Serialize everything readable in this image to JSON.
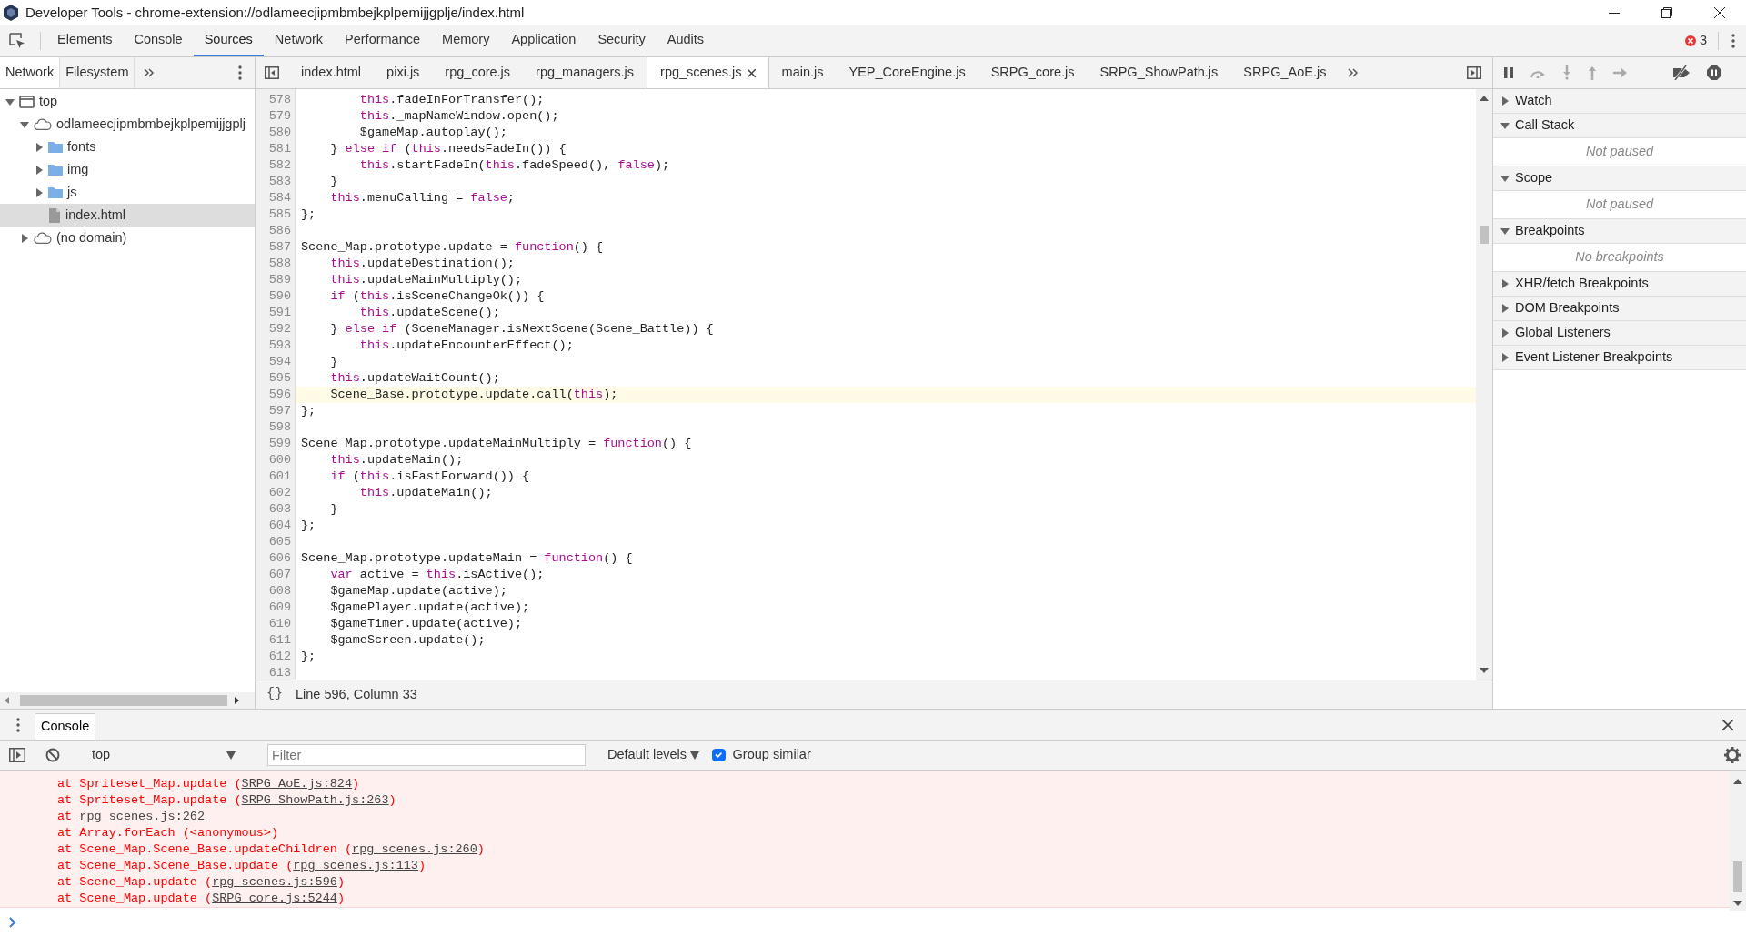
{
  "window": {
    "title": "Developer Tools - chrome-extension://odlameecjipmbmbejkplpemijjgplje/index.html"
  },
  "main_tabs": [
    {
      "label": "Elements",
      "selected": false
    },
    {
      "label": "Console",
      "selected": false
    },
    {
      "label": "Sources",
      "selected": true
    },
    {
      "label": "Network",
      "selected": false
    },
    {
      "label": "Performance",
      "selected": false
    },
    {
      "label": "Memory",
      "selected": false
    },
    {
      "label": "Application",
      "selected": false
    },
    {
      "label": "Security",
      "selected": false
    },
    {
      "label": "Audits",
      "selected": false
    }
  ],
  "error_count": "3",
  "navigator": {
    "tabs": [
      {
        "label": "Network",
        "selected": true
      },
      {
        "label": "Filesystem",
        "selected": false
      }
    ],
    "tree": [
      {
        "label": "top",
        "kind": "frame",
        "expanded": true,
        "selected": false,
        "children": [
          {
            "label": "odlameecjipmbmbejkplpemijjgplj",
            "kind": "domain",
            "expanded": true,
            "selected": false,
            "children": [
              {
                "label": "fonts",
                "kind": "folder",
                "expanded": false,
                "selected": false
              },
              {
                "label": "img",
                "kind": "folder",
                "expanded": false,
                "selected": false
              },
              {
                "label": "js",
                "kind": "folder",
                "expanded": false,
                "selected": false
              },
              {
                "label": "index.html",
                "kind": "file",
                "selected": true
              }
            ]
          },
          {
            "label": "(no domain)",
            "kind": "domain",
            "expanded": false,
            "selected": false
          }
        ]
      }
    ]
  },
  "editor_tabs": [
    {
      "label": "index.html",
      "selected": false
    },
    {
      "label": "pixi.js",
      "selected": false
    },
    {
      "label": "rpg_core.js",
      "selected": false
    },
    {
      "label": "rpg_managers.js",
      "selected": false
    },
    {
      "label": "rpg_scenes.js",
      "selected": true
    },
    {
      "label": "main.js",
      "selected": false
    },
    {
      "label": "YEP_CoreEngine.js",
      "selected": false
    },
    {
      "label": "SRPG_core.js",
      "selected": false
    },
    {
      "label": "SRPG_ShowPath.js",
      "selected": false
    },
    {
      "label": "SRPG_AoE.js",
      "selected": false
    }
  ],
  "code": {
    "lines": [
      {
        "number": "578",
        "current": false,
        "tokens": [
          {
            "kind": "keyword",
            "text": "        this"
          },
          {
            "kind": "plain",
            "text": ".fadeInForTransfer();"
          }
        ]
      },
      {
        "number": "579",
        "current": false,
        "tokens": [
          {
            "kind": "keyword",
            "text": "        this"
          },
          {
            "kind": "plain",
            "text": "._mapNameWindow.open();"
          }
        ]
      },
      {
        "number": "580",
        "current": false,
        "tokens": [
          {
            "kind": "plain",
            "text": "        $gameMap.autoplay();"
          }
        ]
      },
      {
        "number": "581",
        "current": false,
        "tokens": [
          {
            "kind": "plain",
            "text": "    } "
          },
          {
            "kind": "keyword",
            "text": "else if"
          },
          {
            "kind": "plain",
            "text": " ("
          },
          {
            "kind": "keyword",
            "text": "this"
          },
          {
            "kind": "plain",
            "text": ".needsFadeIn()) {"
          }
        ]
      },
      {
        "number": "582",
        "current": false,
        "tokens": [
          {
            "kind": "keyword",
            "text": "        this"
          },
          {
            "kind": "plain",
            "text": ".startFadeIn("
          },
          {
            "kind": "keyword",
            "text": "this"
          },
          {
            "kind": "plain",
            "text": ".fadeSpeed(), "
          },
          {
            "kind": "keyword",
            "text": "false"
          },
          {
            "kind": "plain",
            "text": ");"
          }
        ]
      },
      {
        "number": "583",
        "current": false,
        "tokens": [
          {
            "kind": "plain",
            "text": "    }"
          }
        ]
      },
      {
        "number": "584",
        "current": false,
        "tokens": [
          {
            "kind": "keyword",
            "text": "    this"
          },
          {
            "kind": "plain",
            "text": ".menuCalling = "
          },
          {
            "kind": "keyword",
            "text": "false"
          },
          {
            "kind": "plain",
            "text": ";"
          }
        ]
      },
      {
        "number": "585",
        "current": false,
        "tokens": [
          {
            "kind": "plain",
            "text": "};"
          }
        ]
      },
      {
        "number": "586",
        "current": false
      },
      {
        "number": "587",
        "current": false,
        "tokens": [
          {
            "kind": "plain",
            "text": "Scene_Map.prototype.update = "
          },
          {
            "kind": "keyword",
            "text": "function"
          },
          {
            "kind": "plain",
            "text": "() {"
          }
        ]
      },
      {
        "number": "588",
        "current": false,
        "tokens": [
          {
            "kind": "keyword",
            "text": "    this"
          },
          {
            "kind": "plain",
            "text": ".updateDestination();"
          }
        ]
      },
      {
        "number": "589",
        "current": false,
        "tokens": [
          {
            "kind": "keyword",
            "text": "    this"
          },
          {
            "kind": "plain",
            "text": ".updateMainMultiply();"
          }
        ]
      },
      {
        "number": "590",
        "current": false,
        "tokens": [
          {
            "kind": "keyword",
            "text": "    if"
          },
          {
            "kind": "plain",
            "text": " ("
          },
          {
            "kind": "keyword",
            "text": "this"
          },
          {
            "kind": "plain",
            "text": ".isSceneChangeOk()) {"
          }
        ]
      },
      {
        "number": "591",
        "current": false,
        "tokens": [
          {
            "kind": "keyword",
            "text": "        this"
          },
          {
            "kind": "plain",
            "text": ".updateScene();"
          }
        ]
      },
      {
        "number": "592",
        "current": false,
        "tokens": [
          {
            "kind": "plain",
            "text": "    } "
          },
          {
            "kind": "keyword",
            "text": "else if"
          },
          {
            "kind": "plain",
            "text": " (SceneManager.isNextScene(Scene_Battle)) {"
          }
        ]
      },
      {
        "number": "593",
        "current": false,
        "tokens": [
          {
            "kind": "keyword",
            "text": "        this"
          },
          {
            "kind": "plain",
            "text": ".updateEncounterEffect();"
          }
        ]
      },
      {
        "number": "594",
        "current": false,
        "tokens": [
          {
            "kind": "plain",
            "text": "    }"
          }
        ]
      },
      {
        "number": "595",
        "current": false,
        "tokens": [
          {
            "kind": "keyword",
            "text": "    this"
          },
          {
            "kind": "plain",
            "text": ".updateWaitCount();"
          }
        ]
      },
      {
        "number": "596",
        "current": true,
        "tokens": [
          {
            "kind": "plain",
            "text": "    Scene_Base.prototype.update.call("
          },
          {
            "kind": "keyword",
            "text": "this"
          },
          {
            "kind": "plain",
            "text": ");"
          }
        ]
      },
      {
        "number": "597",
        "current": false,
        "tokens": [
          {
            "kind": "plain",
            "text": "};"
          }
        ]
      },
      {
        "number": "598",
        "current": false
      },
      {
        "number": "599",
        "current": false,
        "tokens": [
          {
            "kind": "plain",
            "text": "Scene_Map.prototype.updateMainMultiply = "
          },
          {
            "kind": "keyword",
            "text": "function"
          },
          {
            "kind": "plain",
            "text": "() {"
          }
        ]
      },
      {
        "number": "600",
        "current": false,
        "tokens": [
          {
            "kind": "keyword",
            "text": "    this"
          },
          {
            "kind": "plain",
            "text": ".updateMain();"
          }
        ]
      },
      {
        "number": "601",
        "current": false,
        "tokens": [
          {
            "kind": "keyword",
            "text": "    if"
          },
          {
            "kind": "plain",
            "text": " ("
          },
          {
            "kind": "keyword",
            "text": "this"
          },
          {
            "kind": "plain",
            "text": ".isFastForward()) {"
          }
        ]
      },
      {
        "number": "602",
        "current": false,
        "tokens": [
          {
            "kind": "keyword",
            "text": "        this"
          },
          {
            "kind": "plain",
            "text": ".updateMain();"
          }
        ]
      },
      {
        "number": "603",
        "current": false,
        "tokens": [
          {
            "kind": "plain",
            "text": "    }"
          }
        ]
      },
      {
        "number": "604",
        "current": false,
        "tokens": [
          {
            "kind": "plain",
            "text": "};"
          }
        ]
      },
      {
        "number": "605",
        "current": false
      },
      {
        "number": "606",
        "current": false,
        "tokens": [
          {
            "kind": "plain",
            "text": "Scene_Map.prototype.updateMain = "
          },
          {
            "kind": "keyword",
            "text": "function"
          },
          {
            "kind": "plain",
            "text": "() {"
          }
        ]
      },
      {
        "number": "607",
        "current": false,
        "tokens": [
          {
            "kind": "keyword",
            "text": "    var"
          },
          {
            "kind": "plain",
            "text": " active = "
          },
          {
            "kind": "keyword",
            "text": "this"
          },
          {
            "kind": "plain",
            "text": ".isActive();"
          }
        ]
      },
      {
        "number": "608",
        "current": false,
        "tokens": [
          {
            "kind": "plain",
            "text": "    $gameMap.update(active);"
          }
        ]
      },
      {
        "number": "609",
        "current": false,
        "tokens": [
          {
            "kind": "plain",
            "text": "    $gamePlayer.update(active);"
          }
        ]
      },
      {
        "number": "610",
        "current": false,
        "tokens": [
          {
            "kind": "plain",
            "text": "    $gameTimer.update(active);"
          }
        ]
      },
      {
        "number": "611",
        "current": false,
        "tokens": [
          {
            "kind": "plain",
            "text": "    $gameScreen.update();"
          }
        ]
      },
      {
        "number": "612",
        "current": false,
        "tokens": [
          {
            "kind": "plain",
            "text": "};"
          }
        ]
      },
      {
        "number": "613",
        "current": false
      }
    ]
  },
  "status_bar": {
    "format_button": "{}",
    "position": "Line 596, Column 33"
  },
  "debugger": {
    "sections": [
      {
        "title": "Watch",
        "expanded": false
      },
      {
        "title": "Call Stack",
        "expanded": true,
        "message": "Not paused"
      },
      {
        "title": "Scope",
        "expanded": true,
        "message": "Not paused"
      },
      {
        "title": "Breakpoints",
        "expanded": true,
        "message": "No breakpoints"
      },
      {
        "title": "XHR/fetch Breakpoints",
        "expanded": false
      },
      {
        "title": "DOM Breakpoints",
        "expanded": false
      },
      {
        "title": "Global Listeners",
        "expanded": false
      },
      {
        "title": "Event Listener Breakpoints",
        "expanded": false
      }
    ]
  },
  "drawer": {
    "tabs": [
      {
        "label": "Console",
        "selected": true
      }
    ]
  },
  "console": {
    "context": "top",
    "filter": {
      "placeholder": "Filter"
    },
    "levels": "Default levels",
    "group_similar": {
      "label": "Group similar",
      "checked": true
    },
    "messages": [
      {
        "prefix": "at Spriteset_Map.update (",
        "link": "SRPG_AoE.js:824",
        "suffix": ")"
      },
      {
        "prefix": "at Spriteset_Map.update (",
        "link": "SRPG_ShowPath.js:263",
        "suffix": ")"
      },
      {
        "prefix": "at ",
        "link": "rpg_scenes.js:262"
      },
      {
        "prefix": "at Array.forEach (<anonymous>)"
      },
      {
        "prefix": "at Scene_Map.Scene_Base.updateChildren (",
        "link": "rpg_scenes.js:260",
        "suffix": ")"
      },
      {
        "prefix": "at Scene_Map.Scene_Base.update (",
        "link": "rpg_scenes.js:113",
        "suffix": ")"
      },
      {
        "prefix": "at Scene_Map.update (",
        "link": "rpg_scenes.js:596",
        "suffix": ")"
      },
      {
        "prefix": "at Scene_Map.update (",
        "link": "SRPG_core.js:5244",
        "suffix": ")"
      }
    ]
  }
}
